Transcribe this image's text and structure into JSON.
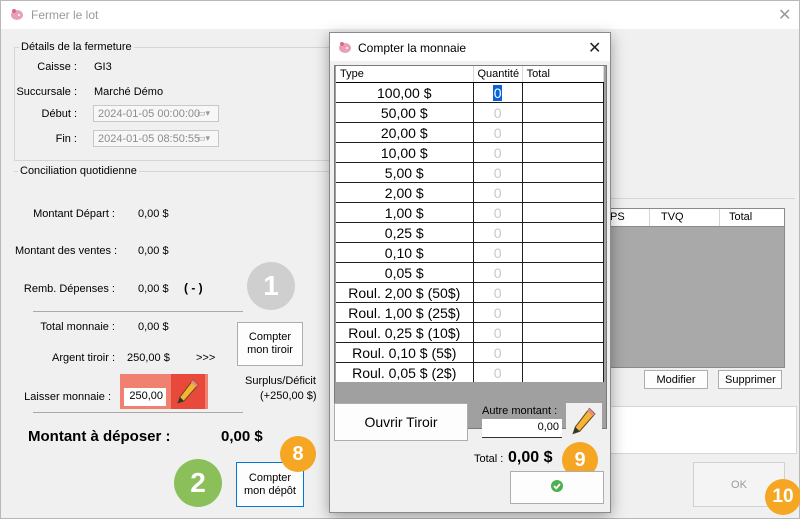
{
  "window": {
    "title": "Fermer le lot"
  },
  "details": {
    "legend": "Détails de la fermeture",
    "caisse_label": "Caisse :",
    "caisse_value": "GI3",
    "succursale_label": "Succursale :",
    "succursale_value": "Marché Démo",
    "debut_label": "Début :",
    "debut_value": "2024-01-05 00:00:00",
    "fin_label": "Fin :",
    "fin_value": "2024-01-05 08:50:55"
  },
  "conciliation": {
    "legend": "Conciliation quotidienne",
    "montant_depart_label": "Montant Départ :",
    "montant_depart_value": "0,00 $",
    "montant_ventes_label": "Montant des ventes :",
    "montant_ventes_value": "0,00 $",
    "remb_label": "Remb. Dépenses :",
    "remb_value": "0,00 $",
    "remb_sign": "( - )",
    "total_monnaie_label": "Total monnaie :",
    "total_monnaie_value": "0,00 $",
    "argent_tiroir_label": "Argent tiroir :",
    "argent_tiroir_value": "250,00 $",
    "arrows": ">>>",
    "laisser_label": "Laisser monnaie :",
    "laisser_value": "250,00",
    "compter_tiroir_line1": "Compter",
    "compter_tiroir_line2": "mon tiroir",
    "surplus_label": "Surplus/Déficit",
    "surplus_value": "(+250,00 $)",
    "montant_deposer_label": "Montant à déposer :",
    "montant_deposer_value": "0,00 $",
    "compter_depot_line1": "Compter",
    "compter_depot_line2": "mon dépôt"
  },
  "taxes_table": {
    "headers": [
      "PS",
      "TVQ",
      "Total"
    ]
  },
  "buttons": {
    "modifier": "Modifier",
    "supprimer": "Supprimer",
    "ok": "OK"
  },
  "badges": {
    "b1": "1",
    "b2": "2",
    "b8": "8",
    "b9": "9",
    "b10": "10"
  },
  "dialog": {
    "title": "Compter la monnaie",
    "columns": [
      "Type",
      "Quantité",
      "Total"
    ],
    "rows": [
      {
        "type": "100,00 $",
        "qty": "0"
      },
      {
        "type": "50,00 $",
        "qty": "0"
      },
      {
        "type": "20,00 $",
        "qty": "0"
      },
      {
        "type": "10,00 $",
        "qty": "0"
      },
      {
        "type": "5,00 $",
        "qty": "0"
      },
      {
        "type": "2,00 $",
        "qty": "0"
      },
      {
        "type": "1,00 $",
        "qty": "0"
      },
      {
        "type": "0,25 $",
        "qty": "0"
      },
      {
        "type": "0,10 $",
        "qty": "0"
      },
      {
        "type": "0,05 $",
        "qty": "0"
      },
      {
        "type": "Roul. 2,00 $ (50$)",
        "qty": "0"
      },
      {
        "type": "Roul. 1,00 $ (25$)",
        "qty": "0"
      },
      {
        "type": "Roul. 0,25 $ (10$)",
        "qty": "0"
      },
      {
        "type": "Roul. 0,10 $ (5$)",
        "qty": "0"
      },
      {
        "type": "Roul. 0,05 $ (2$)",
        "qty": "0"
      }
    ],
    "ouvrir_tiroir": "Ouvrir Tiroir",
    "autre_montant_label": "Autre montant :",
    "autre_montant_value": "0,00",
    "total_label": "Total :",
    "total_value": "0,00 $"
  },
  "colors": {
    "badge_gray": "#cfcfcf",
    "badge_green": "#8bbf5a",
    "badge_orange": "#f5a623",
    "laisser_bg": "#f08070",
    "accent_blue": "#0078d7"
  }
}
